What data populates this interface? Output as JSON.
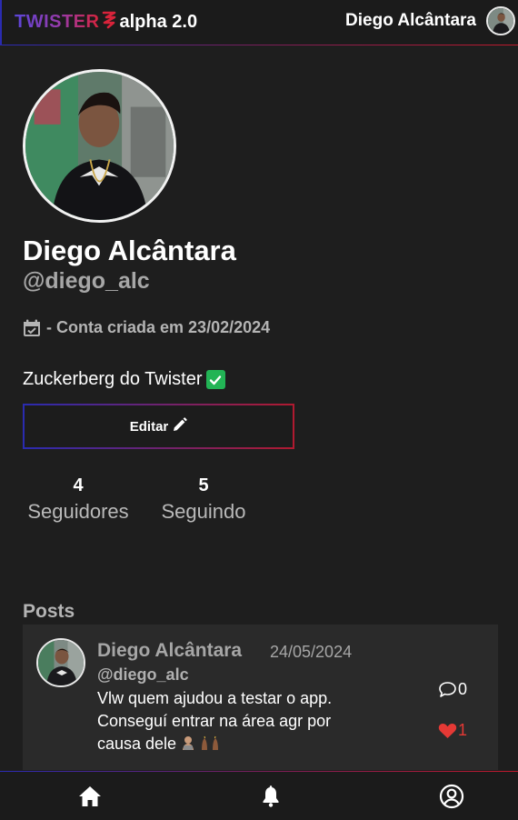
{
  "header": {
    "logo_text": "TWISTER",
    "version_label": "alpha 2.0",
    "username": "Diego Alcântara"
  },
  "profile": {
    "name": "Diego Alcântara",
    "handle": "@diego_alc",
    "created_label": "- Conta criada em 23/02/2024",
    "bio": "Zuckerberg do Twister",
    "edit_label": "Editar",
    "followers_count": "4",
    "followers_label": "Seguidores",
    "following_count": "5",
    "following_label": "Seguindo"
  },
  "posts": {
    "heading": "Posts",
    "items": [
      {
        "author": "Diego Alcântara",
        "date": "24/05/2024",
        "handle": "@diego_alc",
        "text": "Vlw quem ajudou a testar o app. Conseguí entrar na área agr por causa dele",
        "comments": "0",
        "likes": "1"
      }
    ]
  },
  "icons": {
    "calendar": "calendar-icon",
    "verified": "check-badge-icon",
    "edit": "pencil-icon",
    "comment": "comment-bubble-icon",
    "like": "heart-icon",
    "home": "home-icon",
    "notifications": "bell-icon",
    "account": "user-circle-icon"
  },
  "colors": {
    "background": "#1e1e1e",
    "card": "#2a2a2a",
    "accent_blue": "#2a2bb0",
    "accent_red": "#c0182a",
    "like": "#e53935",
    "verified": "#22b455"
  }
}
